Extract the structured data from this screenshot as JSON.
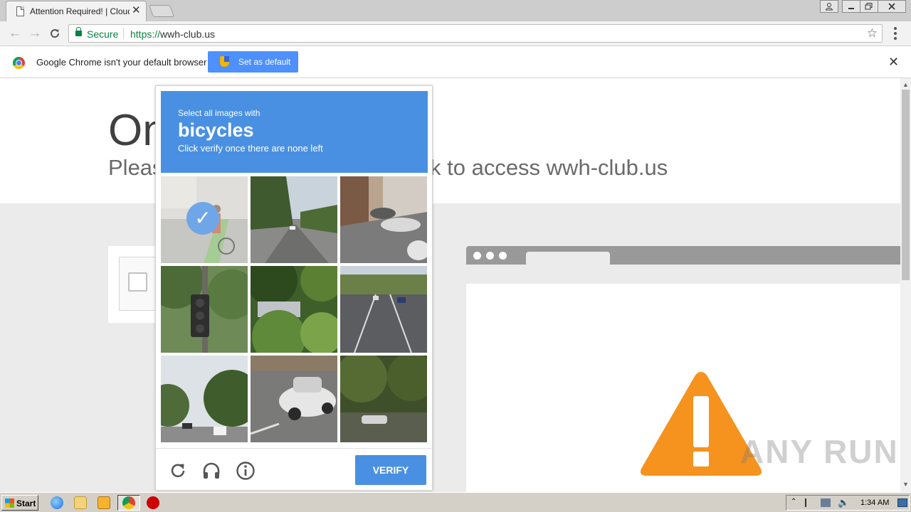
{
  "browser": {
    "tab": {
      "title": "Attention Required! | Cloudflare",
      "close_glyph": "✕"
    },
    "window_controls": [
      "user",
      "minimize",
      "restore",
      "close"
    ],
    "toolbar": {
      "security_label": "Secure",
      "url_scheme": "https://",
      "url_host": "wwh-club.us"
    },
    "infobar": {
      "message": "Google Chrome isn't your default browser",
      "set_default_label": "Set as default",
      "close_glyph": "✕"
    }
  },
  "page": {
    "heading_partial": "On",
    "subheading_left": "Pleas",
    "subheading_right": "k to access wwh-club.us"
  },
  "captcha": {
    "instruction_line1": "Select all images with",
    "target_object": "bicycles",
    "instruction_line3": "Click verify once there are none left",
    "tiles": [
      {
        "scene": "sidewalk-cyclist",
        "selected": true
      },
      {
        "scene": "tree-lined-road",
        "selected": false
      },
      {
        "scene": "parked-cars-alley",
        "selected": false
      },
      {
        "scene": "traffic-light-trees",
        "selected": false
      },
      {
        "scene": "palm-foliage",
        "selected": false
      },
      {
        "scene": "highway",
        "selected": false
      },
      {
        "scene": "city-street",
        "selected": false
      },
      {
        "scene": "white-car-intersection",
        "selected": false
      },
      {
        "scene": "dark-trees-road",
        "selected": false
      }
    ],
    "footer_icons": [
      "reload-icon",
      "audio-icon",
      "info-icon"
    ],
    "verify_label": "VERIFY",
    "accent_color": "#4a90e2"
  },
  "watermark": "ANY RUN",
  "taskbar": {
    "start_label": "Start",
    "clock": "1:34 AM"
  }
}
